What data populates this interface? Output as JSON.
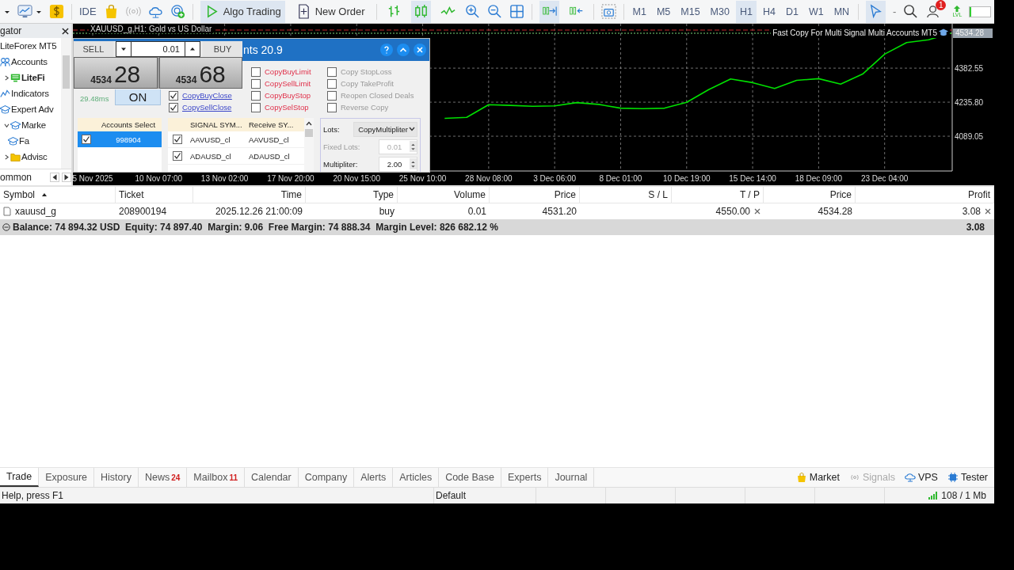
{
  "toolbar": {
    "ide": "IDE",
    "algo_trading": {
      "label": "Algo Trading",
      "selected": true
    },
    "new_order": "New Order",
    "chart_modes": [
      {
        "kind": "bars",
        "selected": false
      },
      {
        "kind": "candles",
        "selected": true
      },
      {
        "kind": "line",
        "selected": false
      }
    ],
    "autoscroll": {
      "selected": true
    },
    "chart_shift": {
      "selected": false
    },
    "timeframes": [
      {
        "label": "M1",
        "selected": false
      },
      {
        "label": "M5",
        "selected": false
      },
      {
        "label": "M15",
        "selected": false
      },
      {
        "label": "M30",
        "selected": false
      },
      {
        "label": "H1",
        "selected": true
      },
      {
        "label": "H4",
        "selected": false
      },
      {
        "label": "D1",
        "selected": false
      },
      {
        "label": "W1",
        "selected": false
      },
      {
        "label": "MN",
        "selected": false
      }
    ],
    "cursor": {
      "selected": true
    },
    "minus": "-",
    "notification_count": "1",
    "lvl": "LVL",
    "level": 0.08
  },
  "navigator": {
    "title": "gator",
    "items": [
      {
        "label": "LiteForex MT5",
        "kind": "root"
      },
      {
        "label": "Accounts",
        "kind": "accounts",
        "children": [
          {
            "label": "LiteFi",
            "kind": "server",
            "expanded": false
          }
        ]
      },
      {
        "label": "Indicators",
        "kind": "indicators"
      },
      {
        "label": "Expert Adv",
        "kind": "experts",
        "children": [
          {
            "label": "Marke",
            "kind": "hat",
            "expanded": true,
            "children": [
              {
                "label": "Fa",
                "kind": "hat"
              }
            ]
          },
          {
            "label": "Advisc",
            "kind": "folder",
            "expanded": false
          }
        ]
      }
    ],
    "bottom_tab": "ommon"
  },
  "chart": {
    "title": "XAUUSD_g,H1: Gold vs US Dollar",
    "ea_name": "Fast Copy For Multi Signal Multi Accounts MT5",
    "price_label": "4534.28",
    "chart_data": {
      "type": "line",
      "ylim": [
        3939,
        4574
      ],
      "grid": true,
      "categories": [
        "5 Nov 2025",
        null,
        null,
        "10 Nov 07:00",
        null,
        null,
        "13 Nov 02:00",
        null,
        null,
        "17 Nov 20:00",
        null,
        null,
        "20 Nov 15:00",
        null,
        null,
        "25 Nov 10:00",
        null,
        null,
        "28 Nov 08:00",
        null,
        null,
        "3 Dec 06:00",
        null,
        null,
        "8 Dec 01:00",
        null,
        null,
        "10 Dec 19:00",
        null,
        null,
        "15 Dec 14:00",
        null,
        null,
        "18 Dec 09:00",
        null,
        null,
        "23 Dec 04:00",
        null,
        null,
        null
      ],
      "yticks": [
        {
          "value": 4089.05,
          "label": "4089.05"
        },
        {
          "value": 4235.8,
          "label": "4235.80"
        },
        {
          "value": 4382.55,
          "label": "4382.55"
        }
      ],
      "series": [
        {
          "color": "#00e000",
          "values": [
            null,
            null,
            null,
            null,
            null,
            null,
            null,
            null,
            null,
            null,
            null,
            null,
            null,
            null,
            null,
            null,
            4166,
            4170,
            4225,
            4222,
            4218,
            4220,
            4234,
            4226,
            4210,
            4208,
            4210,
            4235,
            4290,
            4336,
            4320,
            4295,
            4330,
            4337,
            4314,
            4357,
            4443,
            4493,
            4505,
            4533
          ]
        }
      ]
    }
  },
  "one_click": {
    "sell": "SELL",
    "volume": "0.01",
    "buy": "BUY",
    "bid_big": "4534",
    "bid_small": "28",
    "ask_big": "4534",
    "ask_small": "68"
  },
  "ea_dialog": {
    "title": "nts 20.9",
    "latency": "29.48ms",
    "on_button": "ON",
    "options": [
      {
        "label": "CopyBuyClose",
        "kind": "close",
        "checked": true
      },
      {
        "label": "CopySellClose",
        "kind": "close",
        "checked": true
      },
      {
        "label": "CopyBuyLimit",
        "kind": "pending",
        "checked": false
      },
      {
        "label": "CopySellLimit",
        "kind": "pending",
        "checked": false
      },
      {
        "label": "CopyBuyStop",
        "kind": "pending",
        "checked": false
      },
      {
        "label": "CopySelStop",
        "kind": "pending",
        "checked": false
      },
      {
        "label": "Copy StopLoss",
        "kind": "extra",
        "checked": false
      },
      {
        "label": "Copy TakeProfit",
        "kind": "extra",
        "checked": false
      },
      {
        "label": "Reopen Closed Deals",
        "kind": "extra",
        "checked": false
      },
      {
        "label": "Reverse Copy",
        "kind": "extra",
        "checked": false
      }
    ],
    "accounts": {
      "header": "Accounts Select",
      "rows": [
        {
          "account": "998904",
          "checked": true,
          "selected": true
        }
      ]
    },
    "symbols": {
      "columns": [
        "SIGNAL SYM...",
        "Receive SY..."
      ],
      "rows": [
        {
          "signal": "AAVUSD_cl",
          "receive": "AAVUSD_cl",
          "checked": true
        },
        {
          "signal": "ADAUSD_cl",
          "receive": "ADAUSD_cl",
          "checked": true
        }
      ]
    },
    "lots_label": "Lots:",
    "lots_mode": "CopyMultipliter",
    "fixed_lots_label": "Fixed Lots:",
    "fixed_lots": "0.01",
    "multiplier_label": "Multipliter:",
    "multiplier": "2.00"
  },
  "trade_table": {
    "columns": [
      {
        "label": "Symbol",
        "sorted": true
      },
      {
        "label": "Ticket",
        "sorted": false
      },
      {
        "label": "Time",
        "sorted": false
      },
      {
        "label": "Type",
        "sorted": false
      },
      {
        "label": "Volume",
        "sorted": false
      },
      {
        "label": "Price",
        "sorted": false
      },
      {
        "label": "S / L",
        "sorted": false
      },
      {
        "label": "T / P",
        "sorted": false
      },
      {
        "label": "Price",
        "sorted": false
      },
      {
        "label": "Profit",
        "sorted": false
      }
    ],
    "rows": [
      {
        "cells": [
          {
            "text": "xauusd_g",
            "clear": false
          },
          {
            "text": "208900194",
            "clear": false
          },
          {
            "text": "2025.12.26 21:00:09",
            "clear": false
          },
          {
            "text": "buy",
            "clear": false
          },
          {
            "text": "0.01",
            "clear": false
          },
          {
            "text": "4531.20",
            "clear": false
          },
          {
            "clear": false
          },
          {
            "text": "4550.00",
            "clear": true
          },
          {
            "text": "4534.28",
            "clear": false
          },
          {
            "text": "3.08",
            "clear": true
          }
        ]
      }
    ],
    "summary": {
      "text": "Balance: 74 894.32 USD  Equity: 74 897.40  Margin: 9.06  Free Margin: 74 888.34  Margin Level: 826 682.12 %",
      "profit": "3.08"
    }
  },
  "tabs": [
    {
      "label": "Trade",
      "selected": true
    },
    {
      "label": "Exposure",
      "selected": false
    },
    {
      "label": "History",
      "selected": false
    },
    {
      "label": "News",
      "badge": "24",
      "selected": false
    },
    {
      "label": "Mailbox",
      "badge": "11",
      "selected": false
    },
    {
      "label": "Calendar",
      "selected": false
    },
    {
      "label": "Company",
      "selected": false
    },
    {
      "label": "Alerts",
      "selected": false
    },
    {
      "label": "Articles",
      "selected": false
    },
    {
      "label": "Code Base",
      "selected": false
    },
    {
      "label": "Experts",
      "selected": false
    },
    {
      "label": "Journal",
      "selected": false
    }
  ],
  "services": [
    {
      "label": "Market",
      "kind": "market",
      "disabled": false
    },
    {
      "label": "Signals",
      "kind": "signals",
      "disabled": true
    },
    {
      "label": "VPS",
      "kind": "vps",
      "disabled": false
    },
    {
      "label": "Tester",
      "kind": "tester",
      "disabled": false
    }
  ],
  "status_bar": {
    "help": "Help, press F1",
    "profile": "Default",
    "traffic": "108 / 1 Mb"
  }
}
